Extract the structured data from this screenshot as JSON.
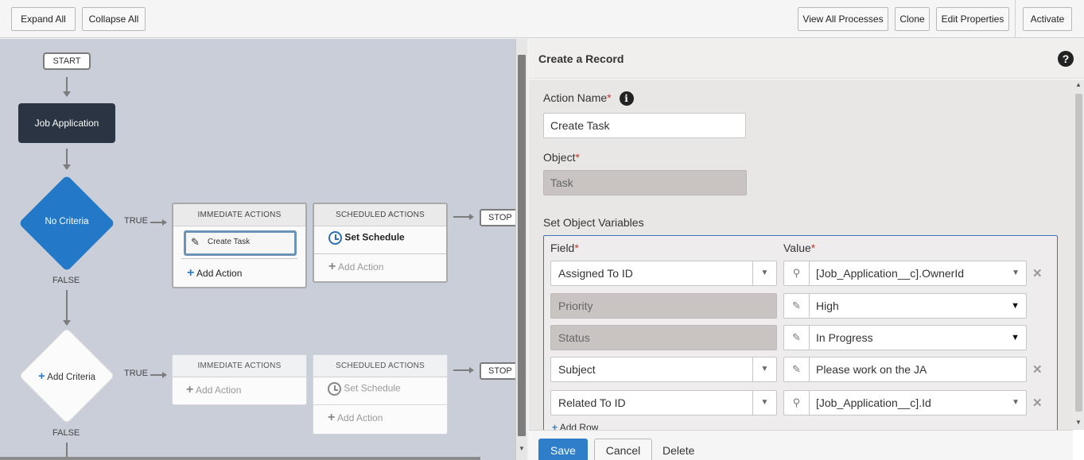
{
  "toolbar": {
    "expand_all": "Expand All",
    "collapse_all": "Collapse All",
    "view_all_processes": "View All Processes",
    "clone": "Clone",
    "edit_properties": "Edit Properties",
    "activate": "Activate"
  },
  "flow": {
    "start": "START",
    "object_node": "Job Application",
    "criteria_1": "No Criteria",
    "criteria_2": "Add Criteria",
    "true_label": "TRUE",
    "false_label": "FALSE",
    "stop": "STOP",
    "row1": {
      "immediate_header": "IMMEDIATE ACTIONS",
      "immediate_action": "Create Task",
      "immediate_add": "Add Action",
      "scheduled_header": "SCHEDULED ACTIONS",
      "set_schedule": "Set Schedule",
      "scheduled_add": "Add Action"
    },
    "row2": {
      "immediate_header": "IMMEDIATE ACTIONS",
      "immediate_add": "Add Action",
      "scheduled_header": "SCHEDULED ACTIONS",
      "set_schedule": "Set Schedule",
      "scheduled_add": "Add Action"
    }
  },
  "editor": {
    "title": "Create a Record",
    "action_name_label": "Action Name",
    "action_name_value": "Create Task",
    "object_label": "Object",
    "object_value": "Task",
    "set_vars_label": "Set Object Variables",
    "field_header": "Field",
    "value_header": "Value",
    "rows": [
      {
        "field": "Assigned To ID",
        "value": "[Job_Application__c].OwnerId"
      },
      {
        "field": "Priority",
        "value": "High"
      },
      {
        "field": "Status",
        "value": "In Progress"
      },
      {
        "field": "Subject",
        "value": "Please work on the JA"
      },
      {
        "field": "Related To ID",
        "value": "[Job_Application__c].Id"
      }
    ],
    "add_row": "Add Row",
    "save": "Save",
    "cancel": "Cancel",
    "delete": "Delete"
  },
  "colors": {
    "accent_blue": "#2e7ec9",
    "node_dark": "#2a3442",
    "criteria_blue": "#2478c8",
    "canvas_bg": "#c9ced8"
  }
}
